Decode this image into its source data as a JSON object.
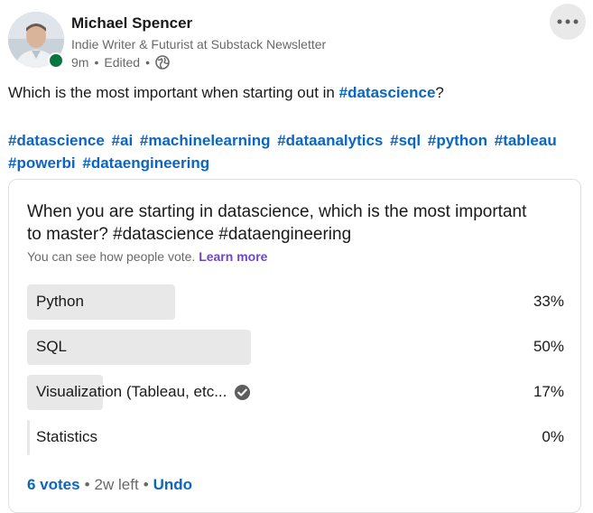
{
  "author": {
    "name": "Michael Spencer",
    "headline": "Indie Writer & Futurist at Substack Newsletter",
    "time": "9m",
    "edited": "Edited"
  },
  "post": {
    "text_before": "Which is the most important when starting out in ",
    "text_hashtag": "#datascience",
    "text_after": "?",
    "hashtags": [
      "#datascience",
      "#ai",
      "#machinelearning",
      "#dataanalytics",
      "#sql",
      "#python",
      "#tableau",
      "#powerbi",
      "#dataengineering"
    ]
  },
  "poll": {
    "question": "When you are starting in datascience, which is the most important to master? #datascience #dataengineering",
    "note": "You can see how people vote.",
    "learn_more": "Learn more",
    "options": [
      {
        "label": "Python",
        "percent": "33%",
        "fraction": 0.33,
        "selected": false
      },
      {
        "label": "SQL",
        "percent": "50%",
        "fraction": 0.5,
        "selected": false
      },
      {
        "label": "Visualization (Tableau, etc...",
        "percent": "17%",
        "fraction": 0.17,
        "selected": true
      },
      {
        "label": "Statistics",
        "percent": "0%",
        "fraction": 0.0,
        "selected": false
      }
    ],
    "votes": "6 votes",
    "time_left": "2w left",
    "undo": "Undo"
  },
  "colors": {
    "link": "#0a66c2",
    "learn_more": "#6e46c4",
    "online": "#057642",
    "bar": "#e8e8e8"
  }
}
